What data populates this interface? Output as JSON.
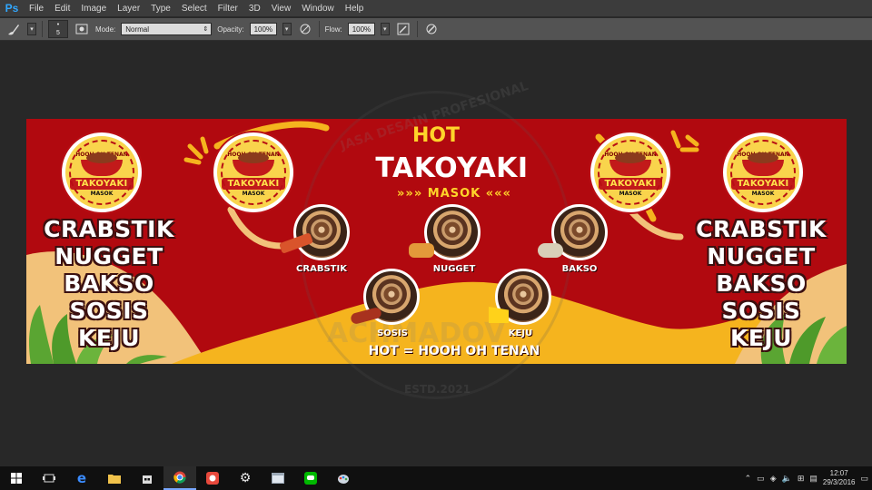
{
  "app": {
    "logo": "Ps"
  },
  "menu": [
    "File",
    "Edit",
    "Image",
    "Layer",
    "Type",
    "Select",
    "Filter",
    "3D",
    "View",
    "Window",
    "Help"
  ],
  "options": {
    "brush_size": "5",
    "mode_label": "Mode:",
    "mode_value": "Normal",
    "opacity_label": "Opacity:",
    "opacity_value": "100%",
    "flow_label": "Flow:",
    "flow_value": "100%"
  },
  "banner": {
    "logo": {
      "tagline": "HOOH OH TENAN",
      "name": "TAKOYAKI",
      "sub": "MASOK"
    },
    "menu_left": [
      "CRABSTIK",
      "NUGGET",
      "BAKSO",
      "SOSIS",
      "KEJU"
    ],
    "menu_right": [
      "CRABSTIK",
      "NUGGET",
      "BAKSO",
      "SOSIS",
      "KEJU"
    ],
    "hot": "HOT",
    "title": "TAKOYAKI",
    "masok": "»»» MASOK «««",
    "foods": [
      "CRABSTIK",
      "NUGGET",
      "BAKSO",
      "SOSIS",
      "KEJU"
    ],
    "footer": "HOT = HOOH OH TENAN",
    "colors": {
      "red": "#b1090f",
      "yellow": "#f5b41e",
      "cream": "#f2c27a",
      "green": "#5aa532"
    }
  },
  "watermark": {
    "top": "JASA DESAIN PROFESIONAL",
    "mid": "ACHMADOV",
    "bottom": "ESTD.2021"
  },
  "taskbar": {
    "icons": [
      "windows-start-icon",
      "task-view-icon",
      "edge-icon",
      "file-explorer-icon",
      "store-icon",
      "chrome-icon",
      "app-red-icon",
      "settings-icon",
      "app-window-icon",
      "line-icon",
      "paint-icon"
    ],
    "time": "12:07",
    "date": "29/3/2016"
  }
}
